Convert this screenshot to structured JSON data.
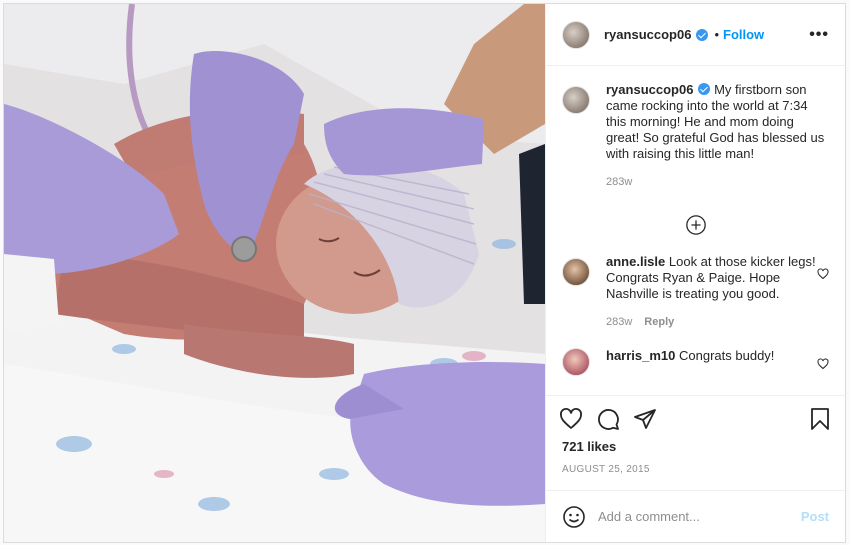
{
  "photo": {
    "subject": "newborn baby in hospital blanket"
  },
  "header": {
    "username": "ryansuccop06",
    "verified": true,
    "separator": "•",
    "follow_label": "Follow",
    "more_label": "•••"
  },
  "caption": {
    "username": "ryansuccop06",
    "text": "My firstborn son came rocking into the world at 7:34 this morning! He and mom doing great! So grateful God has blessed us with raising this little man!",
    "age": "283w"
  },
  "comments": [
    {
      "username": "anne.lisle",
      "text": "Look at those kicker legs! Congrats Ryan & Paige. Hope Nashville is treating you good.",
      "age": "283w",
      "reply_label": "Reply"
    },
    {
      "username": "harris_m10",
      "text": "Congrats buddy!"
    }
  ],
  "likes": "721 likes",
  "date": "AUGUST 25, 2015",
  "add_comment": {
    "placeholder": "Add a comment...",
    "post_label": "Post"
  },
  "icons": {
    "like": "heart-icon",
    "comment": "comment-icon",
    "share": "share-icon",
    "save": "bookmark-icon",
    "emoji": "emoji-icon",
    "load_more": "plus-circle-icon",
    "verified": "verified-badge-icon"
  },
  "colors": {
    "accent": "#0095f6",
    "muted": "#8e8e8e",
    "post_disabled": "#b2dffc",
    "glove": "#a99ad8"
  }
}
